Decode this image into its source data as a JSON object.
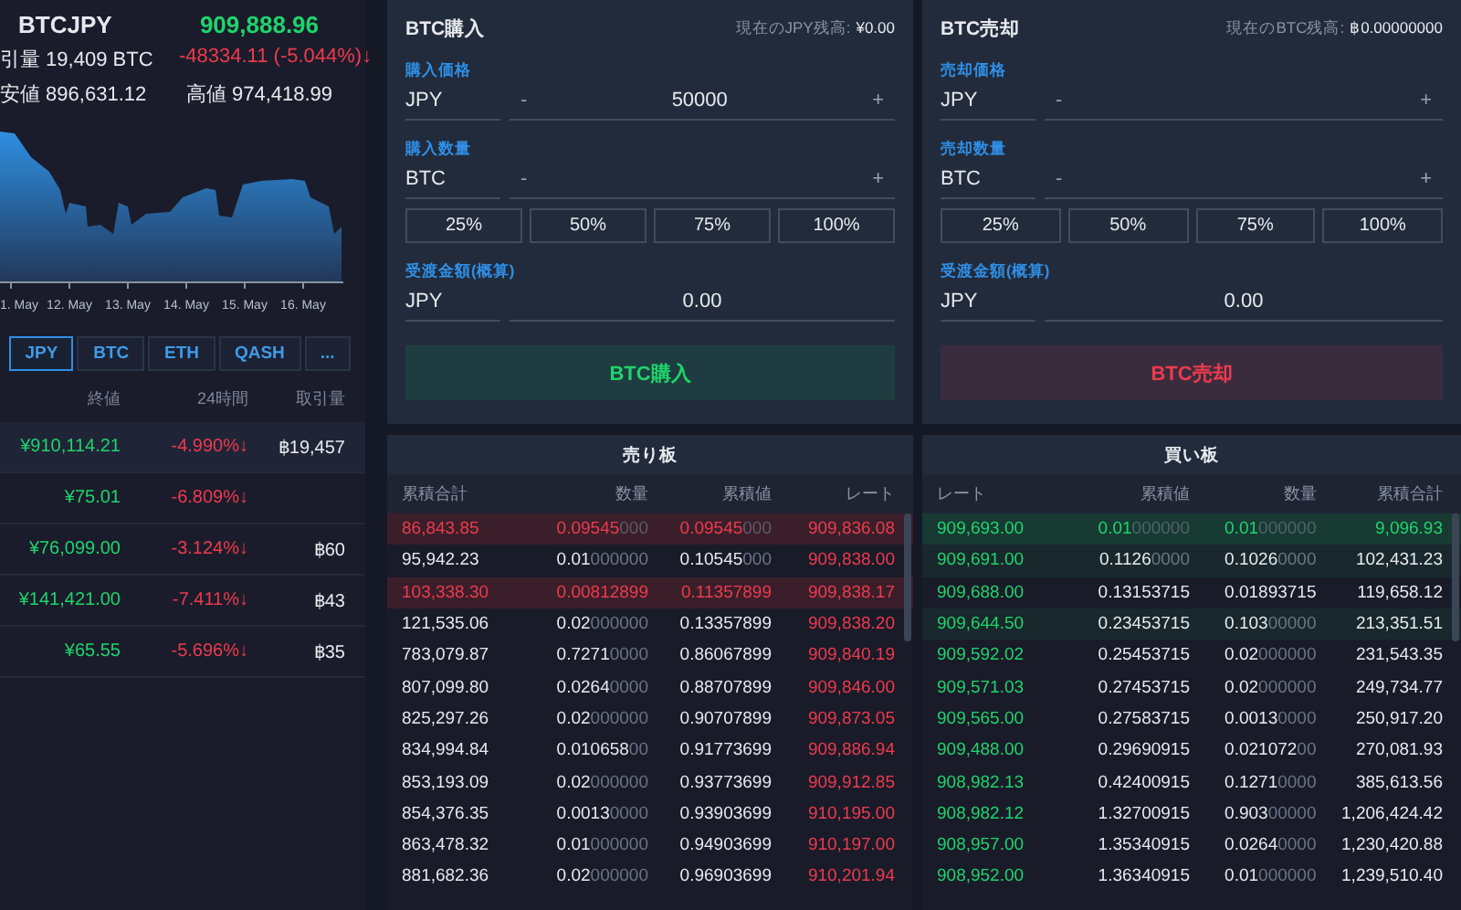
{
  "ticker": {
    "symbol": "BTCJPY",
    "price": "909,888.96",
    "volume": "引量 19,409 BTC",
    "change": "-48334.11 (-5.044%)↓",
    "low": "安値 896,631.12",
    "high": "高値 974,418.99"
  },
  "chart": {
    "x_labels": [
      "1. May",
      "12. May",
      "13. May",
      "14. May",
      "15. May",
      "16. May"
    ]
  },
  "currency_tabs": [
    {
      "label": "JPY",
      "selected": true
    },
    {
      "label": "BTC",
      "selected": false
    },
    {
      "label": "ETH",
      "selected": false
    },
    {
      "label": "QASH",
      "selected": false
    },
    {
      "label": "...",
      "selected": false
    }
  ],
  "markets": {
    "columns": [
      "終値",
      "24時間",
      "取引量"
    ],
    "rows": [
      {
        "price": "¥910,114.21",
        "change": "-4.990%↓",
        "volume": "฿19,457",
        "selected": true
      },
      {
        "price": "¥75.01",
        "change": "-6.809%↓",
        "selected": false
      },
      {
        "price": "¥76,099.00",
        "change": "-3.124%↓",
        "volume": "฿60",
        "selected": false
      },
      {
        "price": "¥141,421.00",
        "change": "-7.411%↓",
        "volume": "฿43",
        "selected": false
      },
      {
        "price": "¥65.55",
        "change": "-5.696%↓",
        "volume": "฿35",
        "selected": false
      }
    ]
  },
  "order_forms": [
    {
      "kind": "buy",
      "title": "BTC購入",
      "balance_label": "現在のJPY残高:",
      "balance": "¥0.00",
      "fields": [
        {
          "kind": "stepper",
          "label": "購入価格",
          "currency": "JPY",
          "minus": "-",
          "value": "50000",
          "plus": "+"
        },
        {
          "kind": "stepper",
          "label": "購入数量",
          "currency": "BTC",
          "minus": "-",
          "plus": "+"
        },
        {
          "kind": "percent",
          "options": [
            "25%",
            "50%",
            "75%",
            "100%"
          ]
        },
        {
          "kind": "readonly",
          "label": "受渡金額(概算)",
          "currency": "JPY",
          "value": "0.00"
        }
      ],
      "submit": "BTC購入"
    },
    {
      "kind": "sell",
      "title": "BTC売却",
      "balance_label": "現在のBTC残高:",
      "balance": "฿0.00000000",
      "fields": [
        {
          "kind": "stepper",
          "label": "売却価格",
          "currency": "JPY",
          "minus": "-",
          "plus": "+"
        },
        {
          "kind": "stepper",
          "label": "売却数量",
          "currency": "BTC",
          "minus": "-",
          "plus": "+"
        },
        {
          "kind": "percent",
          "options": [
            "25%",
            "50%",
            "75%",
            "100%"
          ]
        },
        {
          "kind": "readonly",
          "label": "受渡金額(概算)",
          "currency": "JPY",
          "value": "0.00"
        }
      ],
      "submit": "BTC売却"
    }
  ],
  "order_books": [
    {
      "kind": "sell",
      "title": "売り板",
      "columns": [
        "累積合計",
        "数量",
        "累積値",
        "レート"
      ],
      "rows": [
        {
          "cells": [
            "86,843.85",
            "0.09545000",
            "0.09545000",
            "909,836.08"
          ],
          "kind": "strong"
        },
        {
          "cells": [
            "95,942.23",
            "0.01000000",
            "0.10545000",
            "909,838.00"
          ],
          "kind": "plain"
        },
        {
          "cells": [
            "103,338.30",
            "0.00812899",
            "0.11357899",
            "909,838.17"
          ],
          "kind": "strong"
        },
        {
          "cells": [
            "121,535.06",
            "0.02000000",
            "0.13357899",
            "909,838.20"
          ],
          "kind": "plain"
        },
        {
          "cells": [
            "783,079.87",
            "0.72710000",
            "0.86067899",
            "909,840.19"
          ],
          "kind": "plain"
        },
        {
          "cells": [
            "807,099.80",
            "0.02640000",
            "0.88707899",
            "909,846.00"
          ],
          "kind": "plain"
        },
        {
          "cells": [
            "825,297.26",
            "0.02000000",
            "0.90707899",
            "909,873.05"
          ],
          "kind": "plain"
        },
        {
          "cells": [
            "834,994.84",
            "0.01065800",
            "0.91773699",
            "909,886.94"
          ],
          "kind": "plain"
        },
        {
          "cells": [
            "853,193.09",
            "0.02000000",
            "0.93773699",
            "909,912.85"
          ],
          "kind": "plain"
        },
        {
          "cells": [
            "854,376.35",
            "0.00130000",
            "0.93903699",
            "910,195.00"
          ],
          "kind": "plain"
        },
        {
          "cells": [
            "863,478.32",
            "0.01000000",
            "0.94903699",
            "910,197.00"
          ],
          "kind": "plain"
        },
        {
          "cells": [
            "881,682.36",
            "0.02000000",
            "0.96903699",
            "910,201.94"
          ],
          "kind": "plain"
        }
      ]
    },
    {
      "kind": "buy",
      "title": "買い板",
      "columns": [
        "レート",
        "累積値",
        "数量",
        "累積合計"
      ],
      "rows": [
        {
          "cells": [
            "909,693.00",
            "0.01000000",
            "0.01000000",
            "9,096.93"
          ],
          "kind": "strong"
        },
        {
          "cells": [
            "909,691.00",
            "0.11260000",
            "0.10260000",
            "102,431.23"
          ],
          "kind": "faint"
        },
        {
          "cells": [
            "909,688.00",
            "0.13153715",
            "0.01893715",
            "119,658.12"
          ],
          "kind": "plain"
        },
        {
          "cells": [
            "909,644.50",
            "0.23453715",
            "0.10300000",
            "213,351.51"
          ],
          "kind": "faint"
        },
        {
          "cells": [
            "909,592.02",
            "0.25453715",
            "0.02000000",
            "231,543.35"
          ],
          "kind": "plain"
        },
        {
          "cells": [
            "909,571.03",
            "0.27453715",
            "0.02000000",
            "249,734.77"
          ],
          "kind": "plain"
        },
        {
          "cells": [
            "909,565.00",
            "0.27583715",
            "0.00130000",
            "250,917.20"
          ],
          "kind": "plain"
        },
        {
          "cells": [
            "909,488.00",
            "0.29690915",
            "0.02107200",
            "270,081.93"
          ],
          "kind": "plain"
        },
        {
          "cells": [
            "908,982.13",
            "0.42400915",
            "0.12710000",
            "385,613.56"
          ],
          "kind": "plain"
        },
        {
          "cells": [
            "908,982.12",
            "1.32700915",
            "0.90300000",
            "1,206,424.42"
          ],
          "kind": "plain"
        },
        {
          "cells": [
            "908,957.00",
            "1.35340915",
            "0.02640000",
            "1,230,420.88"
          ],
          "kind": "plain"
        },
        {
          "cells": [
            "908,952.00",
            "1.36340915",
            "0.01000000",
            "1,239,510.40"
          ],
          "kind": "plain"
        }
      ]
    }
  ]
}
